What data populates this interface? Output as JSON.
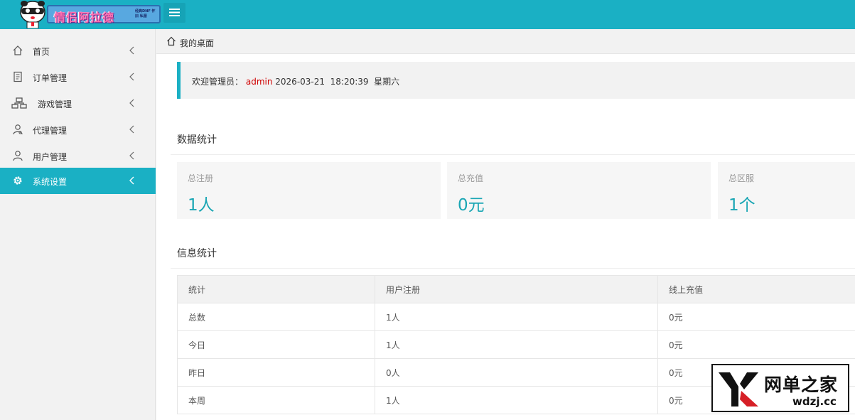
{
  "app": {
    "logo_text": "情侣阿拉德",
    "logo_sub": "经典DNF 怀旧 私服"
  },
  "sidebar": {
    "items": [
      {
        "label": "首页"
      },
      {
        "label": "订单管理"
      },
      {
        "label": "游戏管理"
      },
      {
        "label": "代理管理"
      },
      {
        "label": "用户管理"
      },
      {
        "label": "系统设置"
      }
    ],
    "active_index": 5
  },
  "breadcrumb": {
    "current": "我的桌面"
  },
  "welcome": {
    "prefix": "欢迎管理员：",
    "username": "admin",
    "datetime": "2026-03-21  18:20:39  星期六"
  },
  "data_stats": {
    "title": "数据统计",
    "cards": [
      {
        "label": "总注册",
        "value": "1人"
      },
      {
        "label": "总充值",
        "value": "0元"
      },
      {
        "label": "总区服",
        "value": "1个"
      }
    ]
  },
  "info_stats": {
    "title": "信息统计",
    "headers": [
      "统计",
      "用户注册",
      "线上充值"
    ],
    "rows": [
      [
        "总数",
        "1人",
        "0元"
      ],
      [
        "今日",
        "1人",
        "0元"
      ],
      [
        "昨日",
        "0人",
        "0元"
      ],
      [
        "本周",
        "1人",
        "0元"
      ]
    ]
  },
  "watermark": {
    "main": "网单之家",
    "sub": "wdzj.cc"
  },
  "colors": {
    "accent": "#1ab0c4",
    "username": "#d00000",
    "stat_value": "#1aa6b4"
  }
}
